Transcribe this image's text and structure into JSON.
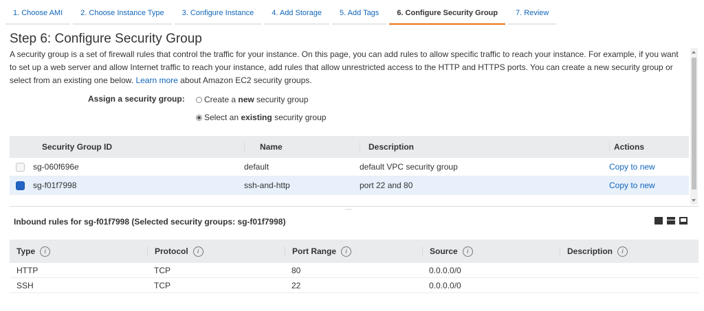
{
  "tabs": [
    {
      "label": "1. Choose AMI"
    },
    {
      "label": "2. Choose Instance Type"
    },
    {
      "label": "3. Configure Instance"
    },
    {
      "label": "4. Add Storage"
    },
    {
      "label": "5. Add Tags"
    },
    {
      "label": "6. Configure Security Group",
      "active": true
    },
    {
      "label": "7. Review"
    }
  ],
  "page": {
    "title": "Step 6: Configure Security Group",
    "intro": "A security group is a set of firewall rules that control the traffic for your instance. On this page, you can add rules to allow specific traffic to reach your instance. For example, if you want to set up a web server and allow Internet traffic to reach your instance, add rules that allow unrestricted access to the HTTP and HTTPS ports. You can create a new security group or select from an existing one below.",
    "learn_more": "Learn more",
    "intro_tail": "about Amazon EC2 security groups."
  },
  "assign": {
    "label": "Assign a security group:",
    "option_new_pre": "Create a ",
    "option_new_bold": "new",
    "option_new_post": " security group",
    "option_existing_pre": "Select an ",
    "option_existing_bold": "existing",
    "option_existing_post": " security group",
    "selected": "existing"
  },
  "security_groups": {
    "headers": {
      "id": "Security Group ID",
      "name": "Name",
      "description": "Description",
      "actions": "Actions"
    },
    "rows": [
      {
        "id": "sg-060f696e",
        "name": "default",
        "description": "default VPC security group",
        "action": "Copy to new",
        "selected": false
      },
      {
        "id": "sg-f01f7998",
        "name": "ssh-and-http",
        "description": "port 22 and 80",
        "action": "Copy to new",
        "selected": true
      }
    ]
  },
  "inbound": {
    "title": "Inbound rules for sg-f01f7998 (Selected security groups: sg-f01f7998)",
    "headers": {
      "type": "Type",
      "protocol": "Protocol",
      "port_range": "Port Range",
      "source": "Source",
      "description": "Description"
    },
    "info_glyph": "i",
    "rows": [
      {
        "type": "HTTP",
        "protocol": "TCP",
        "port_range": "80",
        "source": "0.0.0.0/0",
        "description": ""
      },
      {
        "type": "SSH",
        "protocol": "TCP",
        "port_range": "22",
        "source": "0.0.0.0/0",
        "description": ""
      }
    ]
  },
  "colors": {
    "accent": "#ec7211",
    "link": "#1166bb",
    "selected_row": "#e7f0fb"
  }
}
